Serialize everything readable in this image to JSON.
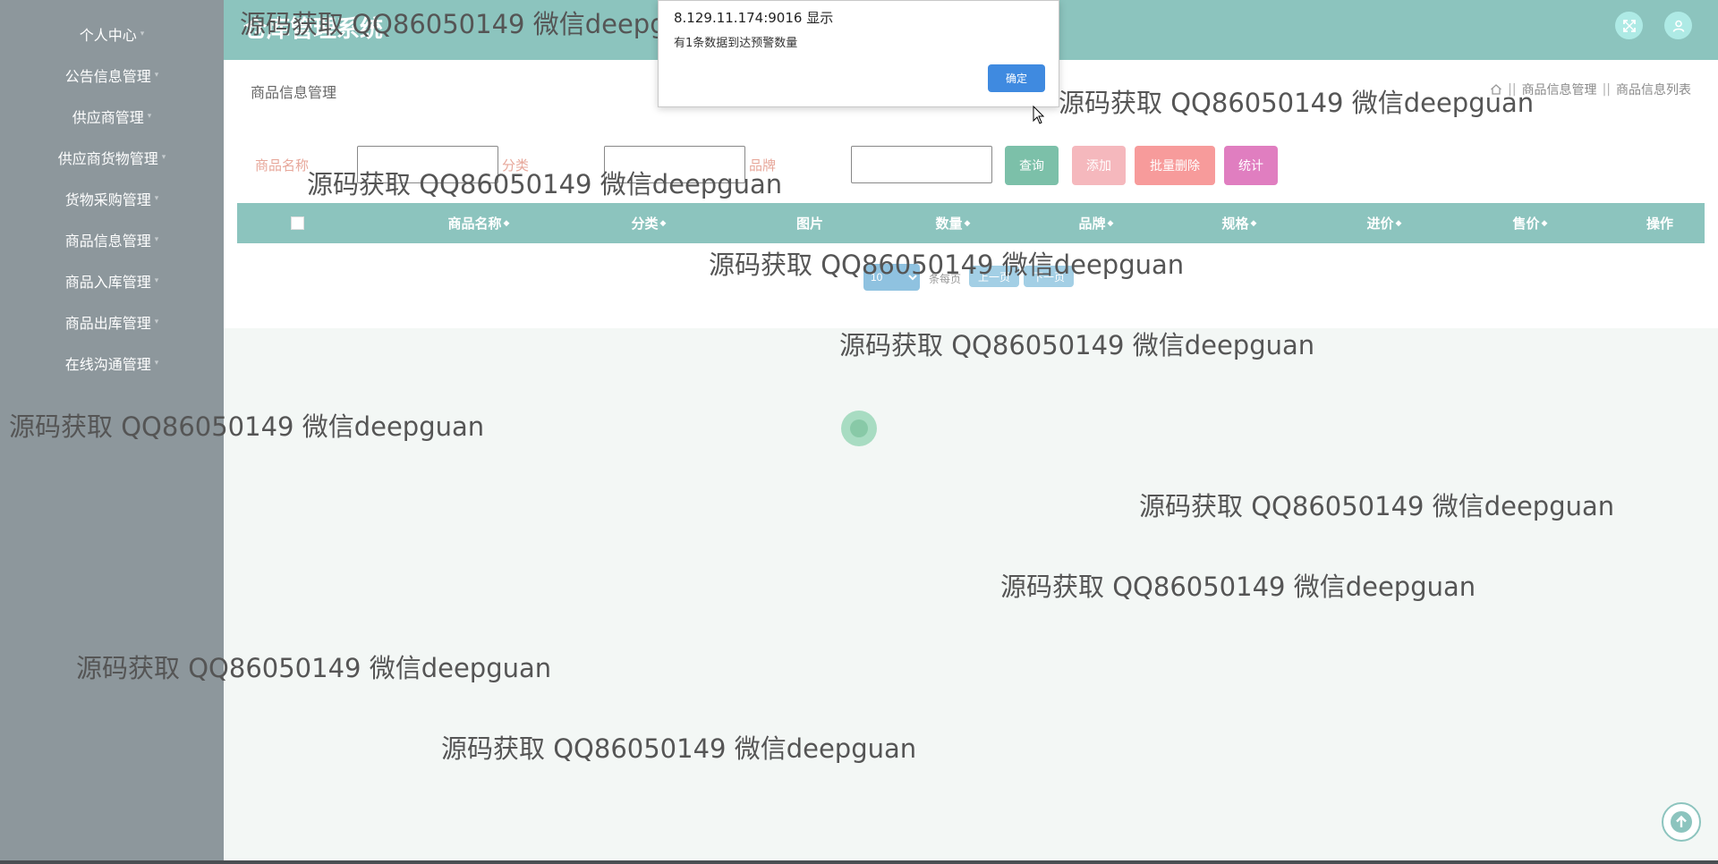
{
  "header": {
    "app_title": "仓库管理系统"
  },
  "sidebar": {
    "items": [
      {
        "label": "个人中心"
      },
      {
        "label": "公告信息管理"
      },
      {
        "label": "供应商管理"
      },
      {
        "label": "供应商货物管理"
      },
      {
        "label": "货物采购管理"
      },
      {
        "label": "商品信息管理"
      },
      {
        "label": "商品入库管理"
      },
      {
        "label": "商品出库管理"
      },
      {
        "label": "在线沟通管理"
      }
    ]
  },
  "page": {
    "title": "商品信息管理",
    "breadcrumb": [
      "商品信息管理",
      "商品信息列表"
    ]
  },
  "search": {
    "name_label": "商品名称",
    "category_label": "分类",
    "brand_label": "品牌",
    "query_button": "查询",
    "add_button": "添加",
    "batch_delete_button": "批量删除",
    "stats_button": "统计"
  },
  "table": {
    "columns": [
      "商品名称",
      "分类",
      "图片",
      "数量",
      "品牌",
      "规格",
      "进价",
      "售价",
      "操作"
    ]
  },
  "pagination": {
    "page_size": "10",
    "per_page_label": "条每页",
    "prev_label": "上一页",
    "next_label": "下一页"
  },
  "dialog": {
    "origin": "8.129.11.174:9016 显示",
    "message": "有1条数据到达预警数量",
    "ok_label": "确定"
  },
  "watermark": "源码获取 QQ86050149 微信deepguan",
  "colors": {
    "sidebar": "#8d979c",
    "header": "#8cc4be",
    "query": "#7cc0a9",
    "add": "#f5b8bd",
    "batch_delete": "#f79b9b",
    "stats": "#e07ec0",
    "dialog_ok": "#3f8ae0"
  }
}
